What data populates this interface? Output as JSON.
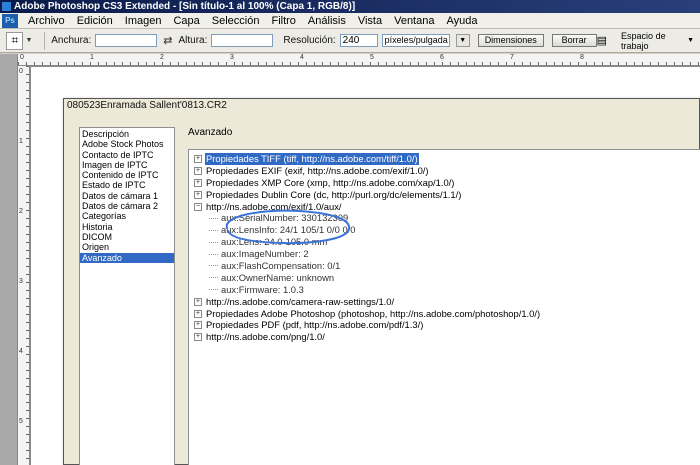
{
  "window": {
    "title": "Adobe Photoshop CS3 Extended - [Sin título-1 al 100% (Capa 1, RGB/8)]"
  },
  "menu": {
    "logo": "Ps",
    "items": [
      "Archivo",
      "Edición",
      "Imagen",
      "Capa",
      "Selección",
      "Filtro",
      "Análisis",
      "Vista",
      "Ventana",
      "Ayuda"
    ]
  },
  "options": {
    "tool_icon": "crop-icon",
    "width_label": "Anchura:",
    "width_value": "",
    "height_label": "Altura:",
    "height_value": "",
    "resolution_label": "Resolución:",
    "resolution_value": "240",
    "unit_value": "píxeles/pulgada",
    "dimensions_button": "Dimensiones",
    "clear_button": "Borrar",
    "workspace_label": "Espacio de trabajo"
  },
  "rulers": {
    "horizontal": [
      "0",
      "1",
      "2",
      "3",
      "4",
      "5",
      "6",
      "7",
      "8"
    ],
    "vertical": [
      "0",
      "1",
      "2",
      "3",
      "4",
      "5"
    ]
  },
  "dialog": {
    "title": "080523Enramada Sallent'0813.CR2",
    "categories": [
      "Descripción",
      "Adobe Stock Photos",
      "Contacto de IPTC",
      "Imagen de IPTC",
      "Contenido de IPTC",
      "Estado de IPTC",
      "Datos de cámara 1",
      "Datos de cámara 2",
      "Categorías",
      "Historia",
      "DICOM",
      "Origen",
      "Avanzado"
    ],
    "selected_category": "Avanzado",
    "section_title": "Avanzado",
    "tree": [
      {
        "label": "Propiedades TIFF (tiff, http://ns.adobe.com/tiff/1.0/)",
        "type": "parent",
        "expander": "+",
        "selected": true
      },
      {
        "label": "Propiedades EXIF (exif, http://ns.adobe.com/exif/1.0/)",
        "type": "parent",
        "expander": "+"
      },
      {
        "label": "Propiedades XMP Core (xmp, http://ns.adobe.com/xap/1.0/)",
        "type": "parent",
        "expander": "+"
      },
      {
        "label": "Propiedades Dublin Core (dc, http://purl.org/dc/elements/1.1/)",
        "type": "parent",
        "expander": "+"
      },
      {
        "label": "http://ns.adobe.com/exif/1.0/aux/",
        "type": "parent",
        "expander": "−"
      },
      {
        "label": "aux:SerialNumber: 330132309",
        "type": "child"
      },
      {
        "label": "aux:LensInfo: 24/1 105/1 0/0 0/0",
        "type": "child"
      },
      {
        "label": "aux:Lens: 24.0-105.0 mm",
        "type": "child"
      },
      {
        "label": "aux:ImageNumber: 2",
        "type": "child"
      },
      {
        "label": "aux:FlashCompensation: 0/1",
        "type": "child"
      },
      {
        "label": "aux:OwnerName: unknown",
        "type": "child"
      },
      {
        "label": "aux:Firmware: 1.0.3",
        "type": "child"
      },
      {
        "label": "http://ns.adobe.com/camera-raw-settings/1.0/",
        "type": "parent",
        "expander": "+"
      },
      {
        "label": "Propiedades Adobe Photoshop (photoshop, http://ns.adobe.com/photoshop/1.0/)",
        "type": "parent",
        "expander": "+"
      },
      {
        "label": "Propiedades PDF (pdf, http://ns.adobe.com/pdf/1.3/)",
        "type": "parent",
        "expander": "+"
      },
      {
        "label": "http://ns.adobe.com/png/1.0/",
        "type": "parent",
        "expander": "+"
      }
    ]
  },
  "colors": {
    "selection": "#316ac5",
    "annotation": "#3a74d8"
  }
}
